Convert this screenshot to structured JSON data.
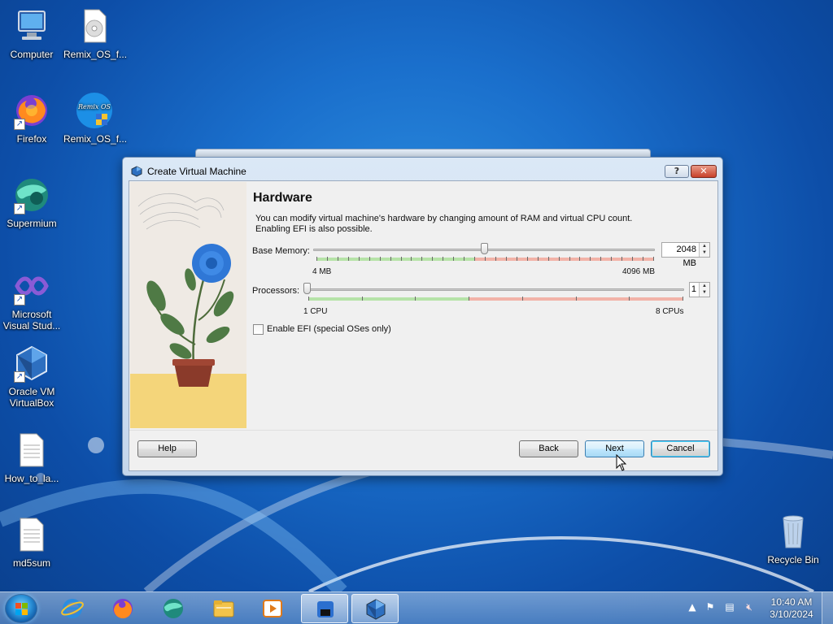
{
  "desktop": {
    "icons": [
      {
        "label": "Computer"
      },
      {
        "label": "Remix_OS_f..."
      },
      {
        "label": "Firefox"
      },
      {
        "label": "Remix_OS_f..."
      },
      {
        "label": "Supermium"
      },
      {
        "label": "Microsoft Visual Stud..."
      },
      {
        "label": "Oracle VM VirtualBox"
      },
      {
        "label": "How_to_la..."
      },
      {
        "label": "md5sum"
      },
      {
        "label": "Recycle Bin"
      }
    ],
    "remix_badge": "Remix OS"
  },
  "dialog": {
    "title": "Create Virtual Machine",
    "help_glyph": "?",
    "close_glyph": "✕",
    "heading": "Hardware",
    "description_line1": "You can modify virtual machine's hardware by changing amount of RAM and virtual CPU count.",
    "description_line2": "Enabling EFI is also possible.",
    "memory": {
      "label": "Base Memory:",
      "value_text": "2048 MB",
      "min_label": "4 MB",
      "max_label": "4096 MB",
      "fraction": 0.5
    },
    "processors": {
      "label": "Processors:",
      "value_text": "1",
      "min_label": "1 CPU",
      "max_label": "8 CPUs",
      "fraction": 0.0
    },
    "efi": {
      "label": "Enable EFI (special OSes only)",
      "checked": false
    },
    "buttons": {
      "help": "Help",
      "back": "Back",
      "next": "Next",
      "cancel": "Cancel"
    }
  },
  "taskbar": {
    "items": [
      {
        "icon": "internet-explorer-icon"
      },
      {
        "icon": "firefox-icon"
      },
      {
        "icon": "supermium-icon"
      },
      {
        "icon": "file-explorer-icon"
      },
      {
        "icon": "media-player-icon"
      },
      {
        "icon": "app-window-icon"
      },
      {
        "icon": "virtualbox-icon"
      }
    ],
    "clock_time": "10:40 AM",
    "clock_date": "3/10/2024"
  },
  "colors": {
    "slider_green": "#b6e3a8",
    "slider_red": "#f2b3a8",
    "accent_blue": "#3c7fb1"
  }
}
